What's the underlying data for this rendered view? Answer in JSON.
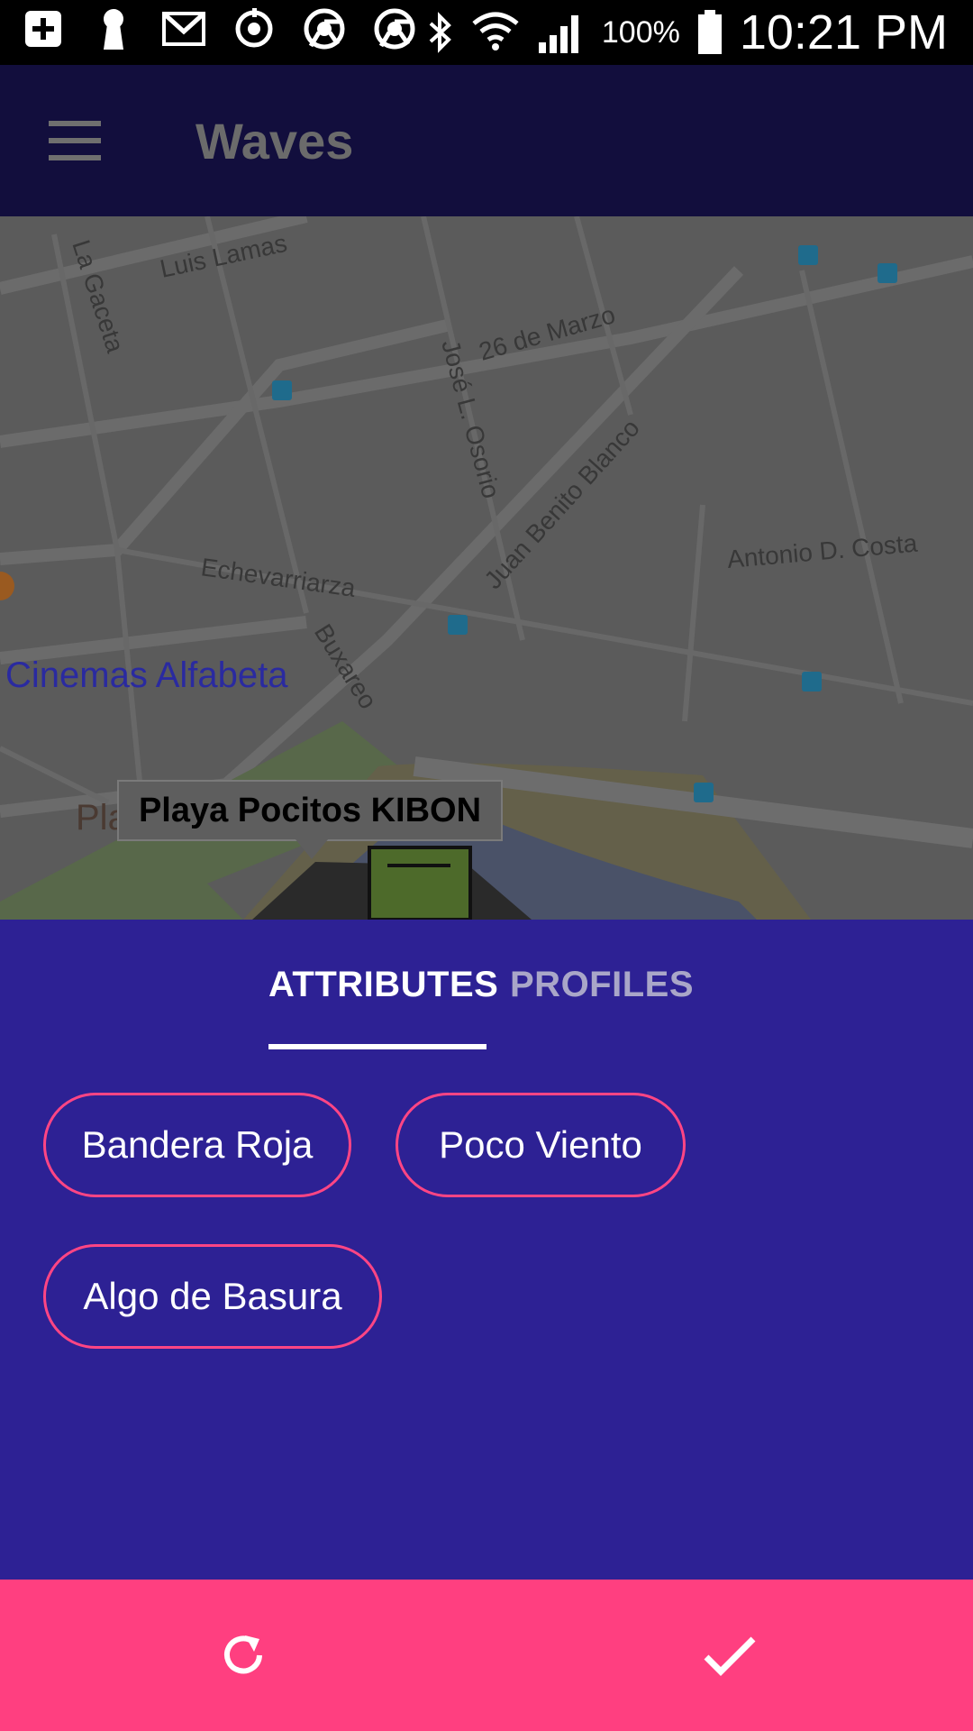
{
  "status_bar": {
    "battery": "100%",
    "time": "10:21 PM",
    "icons": [
      "add-icon",
      "keyhole-icon",
      "gmail-icon",
      "sync-icon",
      "chrome-icon",
      "chrome-icon",
      "bluetooth-icon",
      "wifi-icon",
      "signal-icon",
      "battery-icon"
    ]
  },
  "app_bar": {
    "title": "Waves",
    "menu_icon": "menu-icon"
  },
  "map": {
    "streets": [
      "Luis Lamas",
      "La Gaceta",
      "26 de Marzo",
      "José L. Osorio",
      "Juan Benito Blanco",
      "Antonio D. Costa",
      "Echevarriarza",
      "Buxareo"
    ],
    "places": [
      "Cinemas Alfabeta",
      "Pla"
    ],
    "marker_label": "Playa Pocitos KIBON"
  },
  "tabs": [
    {
      "label": "ATTRIBUTES",
      "active": true
    },
    {
      "label": "PROFILES",
      "active": false
    }
  ],
  "chips": [
    "Bandera Roja",
    "Poco Viento",
    "Algo de Basura"
  ],
  "actions": {
    "refresh_icon": "refresh-icon",
    "confirm_icon": "check-icon"
  },
  "colors": {
    "app_bar": "#120e3d",
    "sheet": "#2d2194",
    "accent": "#ff3f80",
    "chip_border": "#ff4584"
  }
}
